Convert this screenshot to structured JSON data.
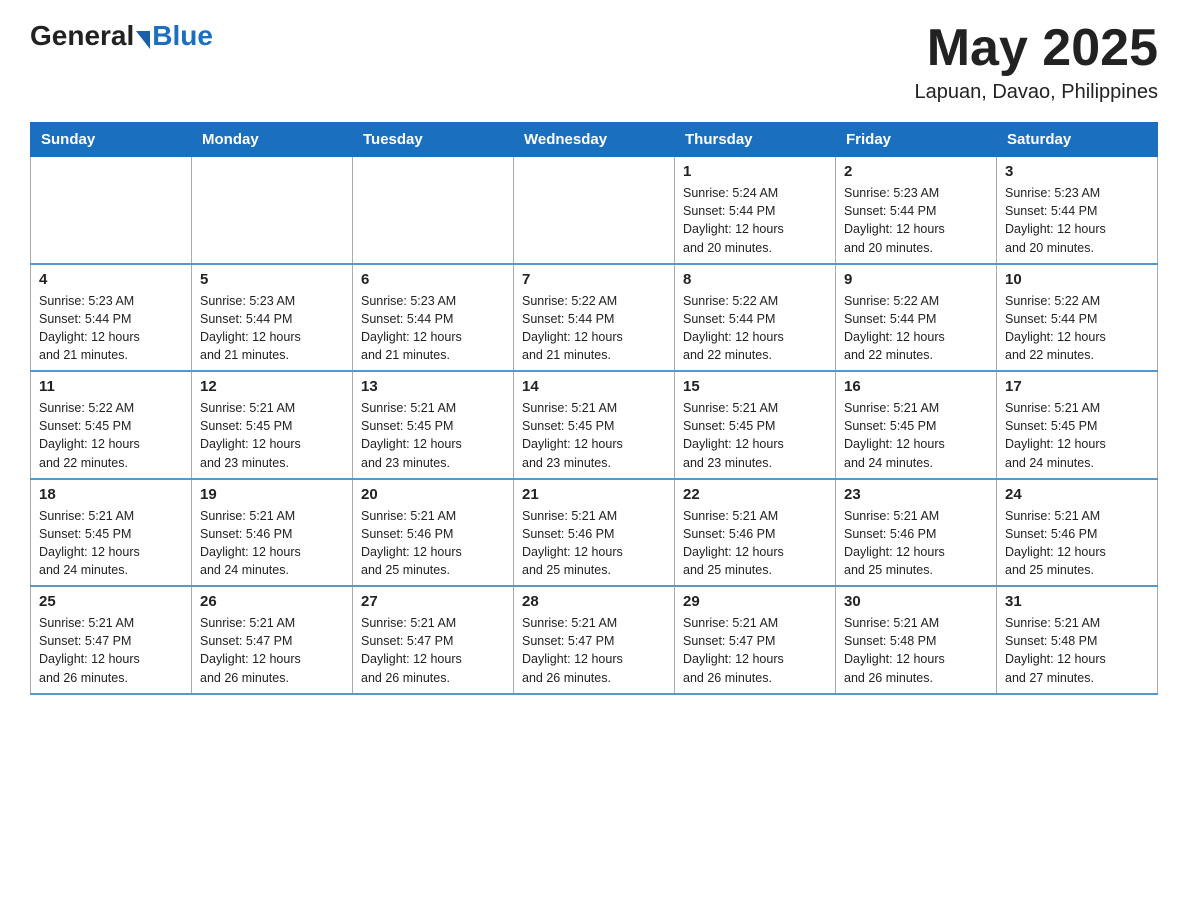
{
  "header": {
    "logo_general": "General",
    "logo_blue": "Blue",
    "month_title": "May 2025",
    "location": "Lapuan, Davao, Philippines"
  },
  "days_of_week": [
    "Sunday",
    "Monday",
    "Tuesday",
    "Wednesday",
    "Thursday",
    "Friday",
    "Saturday"
  ],
  "weeks": [
    [
      {
        "day": "",
        "info": ""
      },
      {
        "day": "",
        "info": ""
      },
      {
        "day": "",
        "info": ""
      },
      {
        "day": "",
        "info": ""
      },
      {
        "day": "1",
        "info": "Sunrise: 5:24 AM\nSunset: 5:44 PM\nDaylight: 12 hours\nand 20 minutes."
      },
      {
        "day": "2",
        "info": "Sunrise: 5:23 AM\nSunset: 5:44 PM\nDaylight: 12 hours\nand 20 minutes."
      },
      {
        "day": "3",
        "info": "Sunrise: 5:23 AM\nSunset: 5:44 PM\nDaylight: 12 hours\nand 20 minutes."
      }
    ],
    [
      {
        "day": "4",
        "info": "Sunrise: 5:23 AM\nSunset: 5:44 PM\nDaylight: 12 hours\nand 21 minutes."
      },
      {
        "day": "5",
        "info": "Sunrise: 5:23 AM\nSunset: 5:44 PM\nDaylight: 12 hours\nand 21 minutes."
      },
      {
        "day": "6",
        "info": "Sunrise: 5:23 AM\nSunset: 5:44 PM\nDaylight: 12 hours\nand 21 minutes."
      },
      {
        "day": "7",
        "info": "Sunrise: 5:22 AM\nSunset: 5:44 PM\nDaylight: 12 hours\nand 21 minutes."
      },
      {
        "day": "8",
        "info": "Sunrise: 5:22 AM\nSunset: 5:44 PM\nDaylight: 12 hours\nand 22 minutes."
      },
      {
        "day": "9",
        "info": "Sunrise: 5:22 AM\nSunset: 5:44 PM\nDaylight: 12 hours\nand 22 minutes."
      },
      {
        "day": "10",
        "info": "Sunrise: 5:22 AM\nSunset: 5:44 PM\nDaylight: 12 hours\nand 22 minutes."
      }
    ],
    [
      {
        "day": "11",
        "info": "Sunrise: 5:22 AM\nSunset: 5:45 PM\nDaylight: 12 hours\nand 22 minutes."
      },
      {
        "day": "12",
        "info": "Sunrise: 5:21 AM\nSunset: 5:45 PM\nDaylight: 12 hours\nand 23 minutes."
      },
      {
        "day": "13",
        "info": "Sunrise: 5:21 AM\nSunset: 5:45 PM\nDaylight: 12 hours\nand 23 minutes."
      },
      {
        "day": "14",
        "info": "Sunrise: 5:21 AM\nSunset: 5:45 PM\nDaylight: 12 hours\nand 23 minutes."
      },
      {
        "day": "15",
        "info": "Sunrise: 5:21 AM\nSunset: 5:45 PM\nDaylight: 12 hours\nand 23 minutes."
      },
      {
        "day": "16",
        "info": "Sunrise: 5:21 AM\nSunset: 5:45 PM\nDaylight: 12 hours\nand 24 minutes."
      },
      {
        "day": "17",
        "info": "Sunrise: 5:21 AM\nSunset: 5:45 PM\nDaylight: 12 hours\nand 24 minutes."
      }
    ],
    [
      {
        "day": "18",
        "info": "Sunrise: 5:21 AM\nSunset: 5:45 PM\nDaylight: 12 hours\nand 24 minutes."
      },
      {
        "day": "19",
        "info": "Sunrise: 5:21 AM\nSunset: 5:46 PM\nDaylight: 12 hours\nand 24 minutes."
      },
      {
        "day": "20",
        "info": "Sunrise: 5:21 AM\nSunset: 5:46 PM\nDaylight: 12 hours\nand 25 minutes."
      },
      {
        "day": "21",
        "info": "Sunrise: 5:21 AM\nSunset: 5:46 PM\nDaylight: 12 hours\nand 25 minutes."
      },
      {
        "day": "22",
        "info": "Sunrise: 5:21 AM\nSunset: 5:46 PM\nDaylight: 12 hours\nand 25 minutes."
      },
      {
        "day": "23",
        "info": "Sunrise: 5:21 AM\nSunset: 5:46 PM\nDaylight: 12 hours\nand 25 minutes."
      },
      {
        "day": "24",
        "info": "Sunrise: 5:21 AM\nSunset: 5:46 PM\nDaylight: 12 hours\nand 25 minutes."
      }
    ],
    [
      {
        "day": "25",
        "info": "Sunrise: 5:21 AM\nSunset: 5:47 PM\nDaylight: 12 hours\nand 26 minutes."
      },
      {
        "day": "26",
        "info": "Sunrise: 5:21 AM\nSunset: 5:47 PM\nDaylight: 12 hours\nand 26 minutes."
      },
      {
        "day": "27",
        "info": "Sunrise: 5:21 AM\nSunset: 5:47 PM\nDaylight: 12 hours\nand 26 minutes."
      },
      {
        "day": "28",
        "info": "Sunrise: 5:21 AM\nSunset: 5:47 PM\nDaylight: 12 hours\nand 26 minutes."
      },
      {
        "day": "29",
        "info": "Sunrise: 5:21 AM\nSunset: 5:47 PM\nDaylight: 12 hours\nand 26 minutes."
      },
      {
        "day": "30",
        "info": "Sunrise: 5:21 AM\nSunset: 5:48 PM\nDaylight: 12 hours\nand 26 minutes."
      },
      {
        "day": "31",
        "info": "Sunrise: 5:21 AM\nSunset: 5:48 PM\nDaylight: 12 hours\nand 27 minutes."
      }
    ]
  ]
}
